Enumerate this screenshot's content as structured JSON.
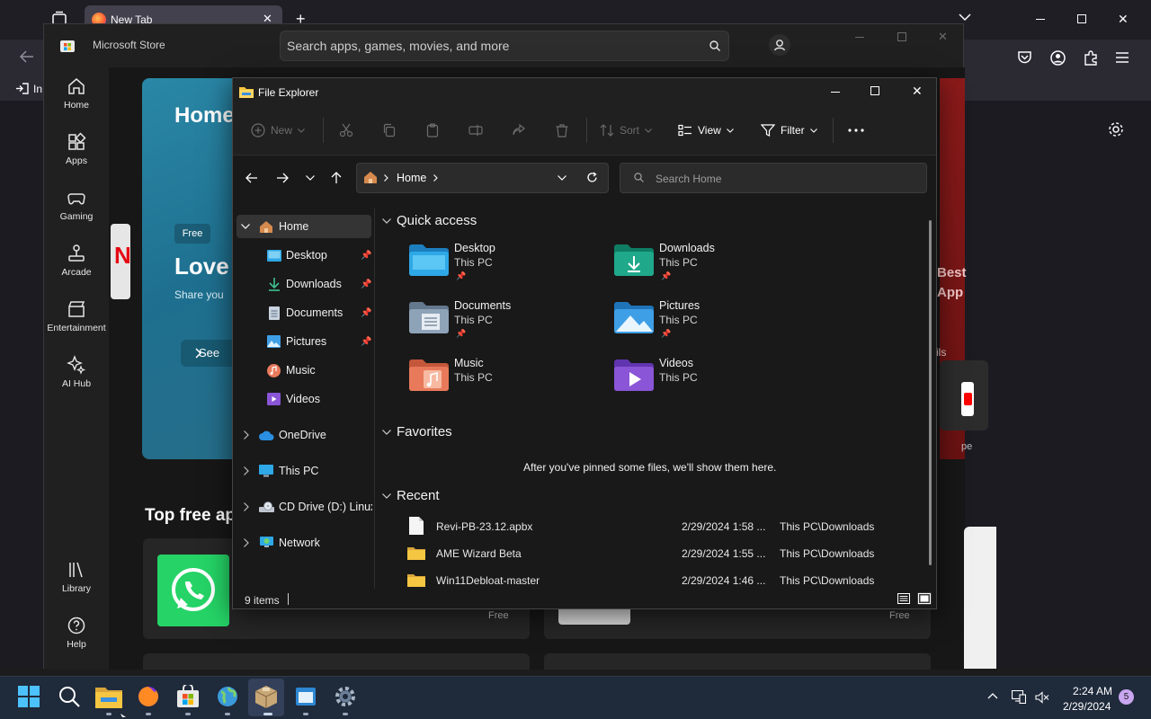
{
  "browser": {
    "tab_title": "New Tab",
    "bookmark_label": "In"
  },
  "store": {
    "title": "Microsoft Store",
    "search_placeholder": "Search apps, games, movies, and more",
    "nav": [
      {
        "label": "Home"
      },
      {
        "label": "Apps"
      },
      {
        "label": "Gaming"
      },
      {
        "label": "Arcade"
      },
      {
        "label": "Entertainment"
      },
      {
        "label": "AI Hub"
      },
      {
        "label": "Library"
      },
      {
        "label": "Help"
      }
    ],
    "hero_title": "Home",
    "hero_badge": "Free",
    "hero_heading": "Love",
    "hero_sub": "Share you",
    "hero_button": "See",
    "section_title": "Top free ap",
    "card_price": "Free",
    "card2_price": "Free",
    "right_best": "Best",
    "right_app": "App",
    "right_ils": "ils",
    "right_pe": "pe"
  },
  "explorer": {
    "title": "File Explorer",
    "cmd": {
      "new": "New",
      "sort": "Sort",
      "view": "View",
      "filter": "Filter"
    },
    "address": {
      "location": "Home"
    },
    "search_placeholder": "Search Home",
    "nav": {
      "home": "Home",
      "desktop": "Desktop",
      "downloads": "Downloads",
      "documents": "Documents",
      "pictures": "Pictures",
      "music": "Music",
      "videos": "Videos",
      "onedrive": "OneDrive",
      "thispc": "This PC",
      "cddrive": "CD Drive (D:) Linux I",
      "network": "Network"
    },
    "quick_access": {
      "heading": "Quick access",
      "items": [
        {
          "name": "Desktop",
          "sub": "This PC"
        },
        {
          "name": "Downloads",
          "sub": "This PC"
        },
        {
          "name": "Documents",
          "sub": "This PC"
        },
        {
          "name": "Pictures",
          "sub": "This PC"
        },
        {
          "name": "Music",
          "sub": "This PC"
        },
        {
          "name": "Videos",
          "sub": "This PC"
        }
      ]
    },
    "favorites": {
      "heading": "Favorites",
      "empty": "After you've pinned some files, we'll show them here."
    },
    "recent": {
      "heading": "Recent",
      "rows": [
        {
          "name": "Revi-PB-23.12.apbx",
          "date": "2/29/2024 1:58 ...",
          "location": "This PC\\Downloads"
        },
        {
          "name": "AME Wizard Beta",
          "date": "2/29/2024 1:55 ...",
          "location": "This PC\\Downloads"
        },
        {
          "name": "Win11Debloat-master",
          "date": "2/29/2024 1:46 ...",
          "location": "This PC\\Downloads"
        }
      ]
    },
    "status": "9 items"
  },
  "taskbar": {
    "time": "2:24 AM",
    "date": "2/29/2024",
    "notification_count": "5"
  },
  "colors": {
    "desktop_folder": "#2ea8e6",
    "downloads_folder": "#1fa98a",
    "documents_folder": "#8fa3b8",
    "pictures_folder": "#3f9fe6",
    "music_folder": "#e87a5b",
    "videos_folder": "#8a55d6",
    "whatsapp": "#25d366"
  }
}
